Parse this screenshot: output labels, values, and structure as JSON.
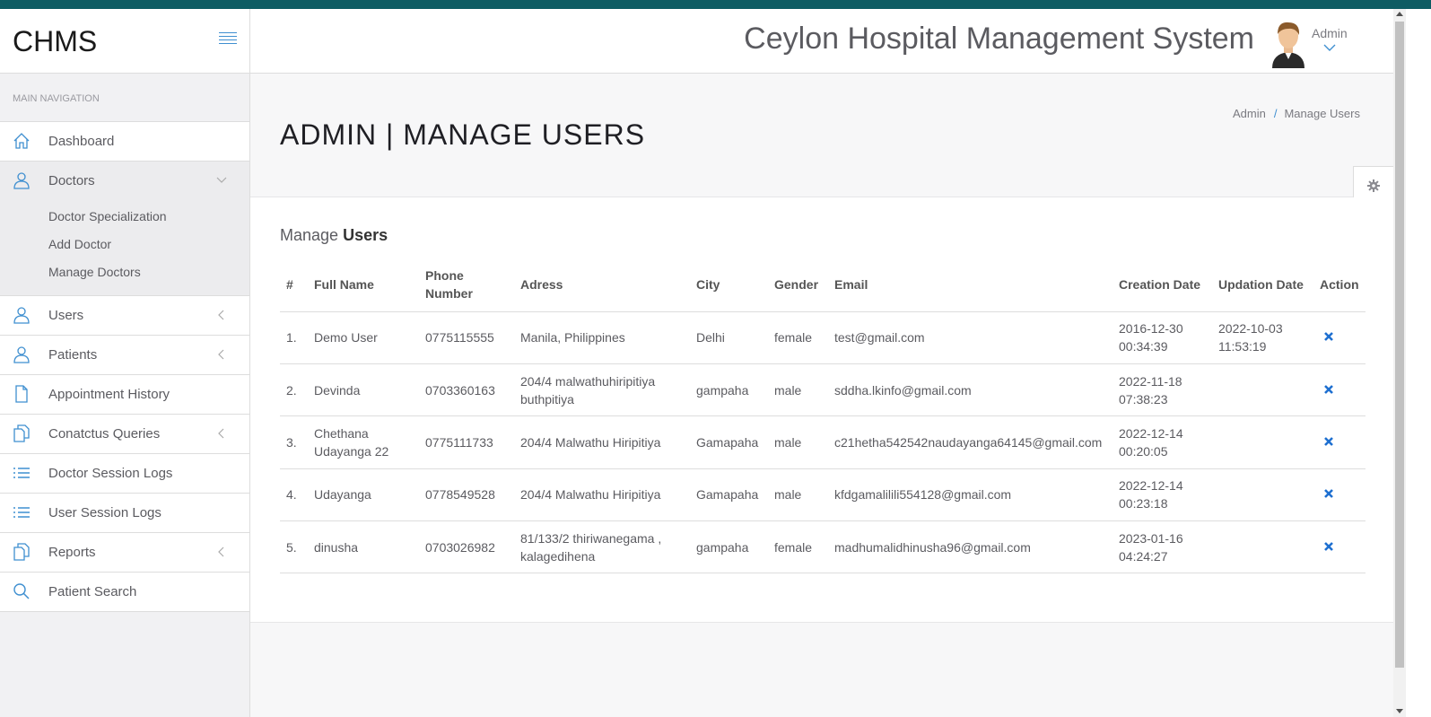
{
  "brand": "CHMS",
  "app_title": "Ceylon Hospital Management System",
  "user": {
    "name": "Admin"
  },
  "sidebar": {
    "heading": "MAIN NAVIGATION",
    "items": [
      {
        "label": "Dashboard",
        "icon": "home-icon"
      },
      {
        "label": "Doctors",
        "icon": "user-icon",
        "expanded": true,
        "children": [
          "Doctor Specialization",
          "Add Doctor",
          "Manage Doctors"
        ]
      },
      {
        "label": "Users",
        "icon": "user-icon"
      },
      {
        "label": "Patients",
        "icon": "user-icon"
      },
      {
        "label": "Appointment History",
        "icon": "file-icon"
      },
      {
        "label": "Conatctus Queries",
        "icon": "files-icon"
      },
      {
        "label": "Doctor Session Logs",
        "icon": "list-icon"
      },
      {
        "label": "User Session Logs",
        "icon": "list-icon"
      },
      {
        "label": "Reports",
        "icon": "files-icon"
      },
      {
        "label": "Patient Search",
        "icon": "search-icon"
      }
    ]
  },
  "page": {
    "title": "ADMIN | MANAGE USERS",
    "breadcrumb": [
      "Admin",
      "/",
      "Manage Users"
    ]
  },
  "panel": {
    "title_prefix": "Manage",
    "title_bold": "Users"
  },
  "table": {
    "columns": [
      "#",
      "Full Name",
      "Phone Number",
      "Adress",
      "City",
      "Gender",
      "Email",
      "Creation Date",
      "Updation Date",
      "Action"
    ],
    "rows": [
      {
        "num": "1.",
        "name": "Demo User",
        "phone": "0775115555",
        "address": "Manila, Philippines",
        "city": "Delhi",
        "gender": "female",
        "email": "test@gmail.com",
        "created": "2016-12-30 00:34:39",
        "updated": "2022-10-03 11:53:19"
      },
      {
        "num": "2.",
        "name": "Devinda",
        "phone": "0703360163",
        "address": "204/4 malwathuhiripitiya buthpitiya",
        "city": "gampaha",
        "gender": "male",
        "email": "sddha.lkinfo@gmail.com",
        "created": "2022-11-18 07:38:23",
        "updated": ""
      },
      {
        "num": "3.",
        "name": "Chethana Udayanga 22",
        "phone": "0775111733",
        "address": "204/4 Malwathu Hiripitiya",
        "city": "Gamapaha",
        "gender": "male",
        "email": "c21hetha542542naudayanga64145@gmail.com",
        "created": "2022-12-14 00:20:05",
        "updated": ""
      },
      {
        "num": "4.",
        "name": "Udayanga",
        "phone": "0778549528",
        "address": "204/4 Malwathu Hiripitiya",
        "city": "Gamapaha",
        "gender": "male",
        "email": "kfdgamalilili554128@gmail.com",
        "created": "2022-12-14 00:23:18",
        "updated": ""
      },
      {
        "num": "5.",
        "name": "dinusha",
        "phone": "0703026982",
        "address": "81/133/2 thiriwanegama , kalagedihena",
        "city": "gampaha",
        "gender": "female",
        "email": "madhumalidhinusha96@gmail.com",
        "created": "2023-01-16 04:24:27",
        "updated": ""
      }
    ]
  },
  "colors": {
    "accent": "#3f8fd0",
    "topbar": "#0e5c63",
    "delete": "#1e6fd0"
  }
}
